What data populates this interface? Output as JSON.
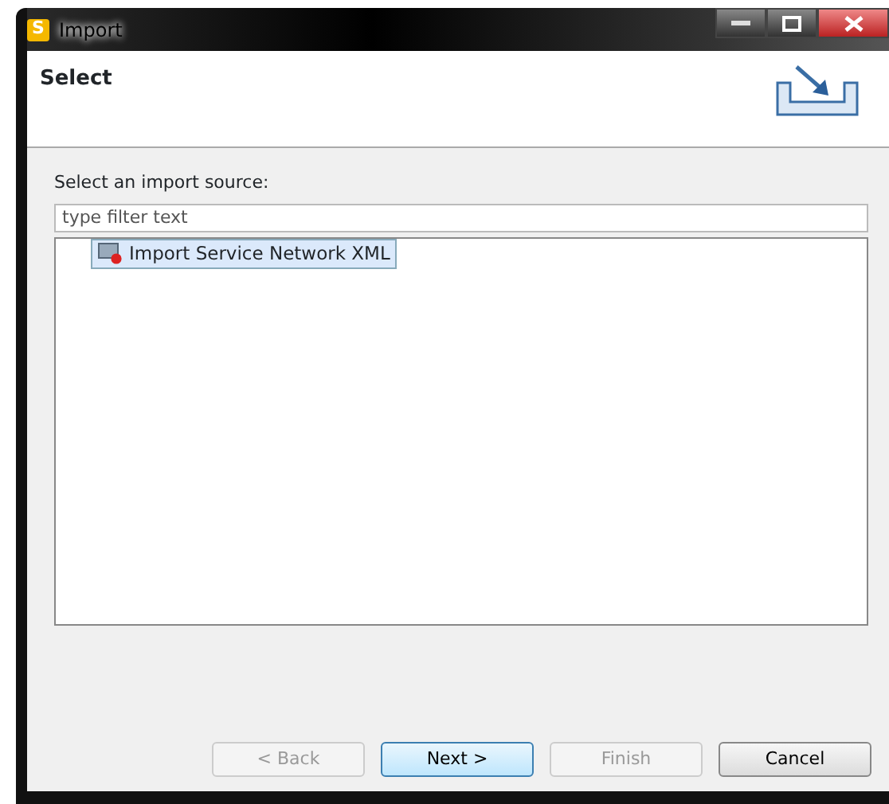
{
  "window": {
    "title": "Import",
    "app_icon": "S"
  },
  "header": {
    "title": "Select"
  },
  "source_label": "Select an import source:",
  "filter": {
    "placeholder": "type filter text"
  },
  "tree": [
    {
      "label": "Import Service Network XML",
      "selected": true
    }
  ],
  "buttons": [
    {
      "label": "< Back",
      "disabled": true,
      "default": false
    },
    {
      "label": "Next >",
      "disabled": false,
      "default": true
    },
    {
      "label": "Finish",
      "disabled": true,
      "default": false
    },
    {
      "label": "Cancel",
      "disabled": false,
      "default": false
    }
  ]
}
